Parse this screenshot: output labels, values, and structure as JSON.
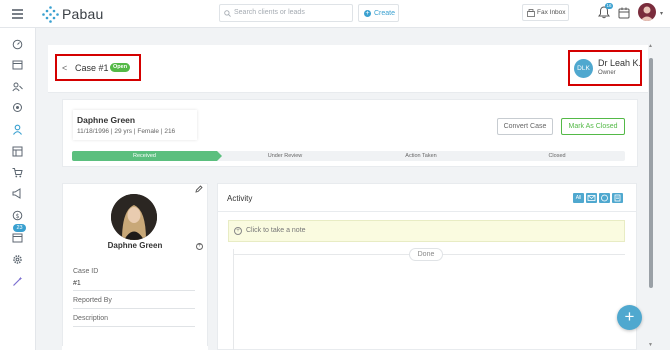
{
  "brand": {
    "name": "Pabau"
  },
  "header": {
    "search_placeholder": "Search clients or leads",
    "create_label": "Create",
    "fax_label": "Fax Inbox",
    "notification_count": "16"
  },
  "sidebar": {
    "badge": "23"
  },
  "case": {
    "back": "<",
    "title": "Case #1",
    "status": "Open",
    "owner_initials": "DLK",
    "owner_name": "Dr Leah K.",
    "owner_role": "Owner"
  },
  "patient": {
    "name": "Daphne Green",
    "meta": "11/18/1996  |  29 yrs  |  Female  |  216",
    "convert_label": "Convert Case",
    "close_label": "Mark As Closed"
  },
  "progress": {
    "steps": [
      "Received",
      "Under Review",
      "Action Taken",
      "Closed"
    ],
    "current_step": 1
  },
  "profile": {
    "name": "Daphne Green",
    "case_id_label": "Case ID",
    "case_id_value": "#1",
    "reported_by_label": "Reported By",
    "description_label": "Description"
  },
  "activity": {
    "title": "Activity",
    "note_placeholder": "Click to take a note",
    "done_label": "Done",
    "toolbar": [
      "All",
      "email",
      "sms",
      "note"
    ]
  },
  "fab_label": "+",
  "colors": {
    "accent": "#4fa8cf",
    "green": "#54b947",
    "progress_green": "#5bbf7e",
    "highlight_red": "#d40000"
  }
}
